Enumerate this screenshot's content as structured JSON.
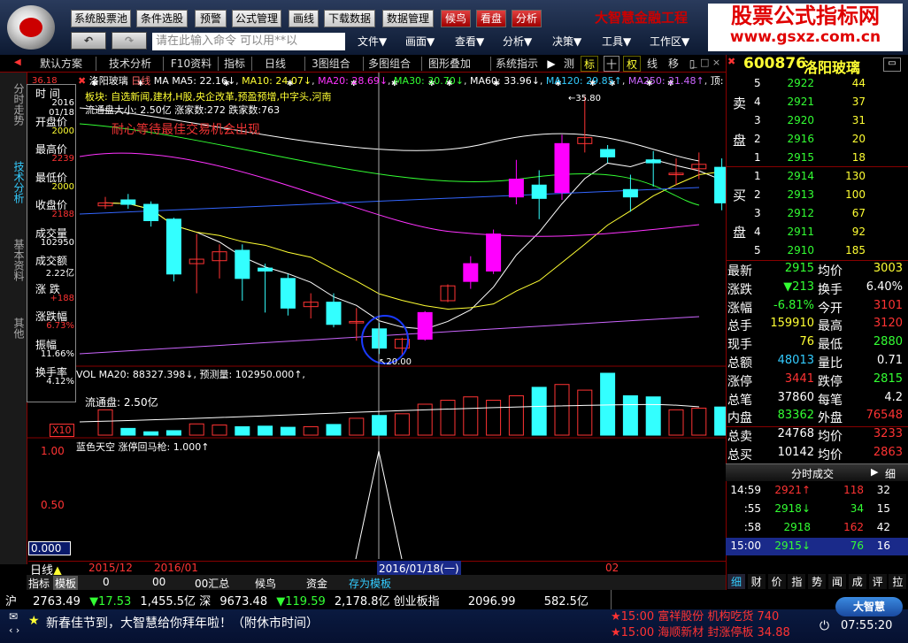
{
  "topbar": {
    "buttons": [
      "系统股票池",
      "条件选股",
      "预警",
      "公式管理",
      "画线",
      "下载数据",
      "数据管理",
      "候鸟",
      "看盘",
      "分析"
    ],
    "brand": "大智慧金融工程",
    "watermark_line1": "股票公式指标网",
    "watermark_line2": "www.gsxz.com.cn",
    "command_placeholder": "请在此输入命令  可以用**以",
    "menus": [
      "文件▼",
      "画面▼",
      "查看▼",
      "分析▼",
      "决策▼",
      "工具▼",
      "工作区▼"
    ],
    "window_buttons": [
      "_",
      "□",
      "×"
    ]
  },
  "toolbar": {
    "tabs": [
      "默认方案",
      "技术分析",
      "F10资料",
      "指标",
      "日线",
      "3图组合",
      "多图组合",
      "图形叠加",
      "系统指示"
    ],
    "right_tabs": [
      "测",
      "标",
      "十",
      "权",
      "线",
      "移"
    ]
  },
  "sidetabs": [
    "分时走势",
    "技术分析",
    "基本资料",
    "其他"
  ],
  "chart": {
    "title": "洛阳玻璃",
    "period": "日线",
    "ma_line": {
      "ma": "MA",
      "ma5": "MA5: 22.16↓",
      "ma10": "MA10: 24.07↓",
      "ma20": "MA20: 28.69↓",
      "ma30": "MA30: 30.70↓",
      "ma60": "MA60: 33.96↓",
      "ma120": "MA120: 29.85↑",
      "ma250": "MA250: 21.48↑",
      "top": "顶: 36"
    },
    "block_info": "板块: 自选新闻,建材,H股,央企改革,预盈预增,中字头,河南",
    "float_info": "流通盘大小: 2.50亿   涨家数:272   跌家数:763",
    "annotation": "耐心等待最佳交易机会出现",
    "high_label": "35.80",
    "low_label": "20.00",
    "y_top_label": "36.18",
    "vol_header": "VOL MA20: 88327.398↓, 预测量: 102950.000↑,",
    "vol_float": "流通盘: 2.50亿",
    "vol_unit": "X10",
    "ind_header_name": "蓝色天空",
    "ind_header_value": "涨停回马枪: 1.000↑",
    "ind_y_labels": [
      "1.00",
      "0.50",
      "0.000"
    ],
    "x_labels": [
      "2015/12",
      "2016/01",
      "2016/01/18(一)",
      "02"
    ],
    "candles": [
      {
        "o": 28.4,
        "c": 28.6,
        "h": 29.0,
        "l": 28.2,
        "up": true
      },
      {
        "o": 28.8,
        "c": 28.5,
        "h": 29.2,
        "l": 28.2,
        "up": false
      },
      {
        "o": 28.5,
        "c": 27.4,
        "h": 28.7,
        "l": 27.0,
        "up": false
      },
      {
        "o": 27.5,
        "c": 23.8,
        "h": 27.6,
        "l": 23.3,
        "up": false
      },
      {
        "o": 24.5,
        "c": 24.8,
        "h": 26.5,
        "l": 22.5,
        "up": true
      },
      {
        "o": 24.7,
        "c": 25.3,
        "h": 25.8,
        "l": 23.5,
        "up": true
      },
      {
        "o": 25.4,
        "c": 23.5,
        "h": 25.8,
        "l": 22.0,
        "up": false
      },
      {
        "o": 24.2,
        "c": 24.0,
        "h": 24.5,
        "l": 21.2,
        "up": false
      },
      {
        "o": 23.5,
        "c": 21.5,
        "h": 23.8,
        "l": 21.0,
        "up": false
      },
      {
        "o": 21.6,
        "c": 21.9,
        "h": 22.5,
        "l": 20.8,
        "up": true
      },
      {
        "o": 21.9,
        "c": 20.4,
        "h": 22.5,
        "l": 20.2,
        "up": false
      },
      {
        "o": 20.5,
        "c": 20.6,
        "h": 21.5,
        "l": 19.3,
        "up": true
      },
      {
        "o": 20.1,
        "c": 18.8,
        "h": 20.5,
        "l": 18.4,
        "up": false
      },
      {
        "o": 18.8,
        "c": 19.4,
        "h": 19.5,
        "l": 18.3,
        "up": true
      },
      {
        "o": 19.4,
        "c": 21.2,
        "h": 21.3,
        "l": 19.3,
        "up": true
      },
      {
        "o": 22.0,
        "c": 23.0,
        "h": 23.1,
        "l": 21.9,
        "up": true
      },
      {
        "o": 23.3,
        "c": 24.5,
        "h": 25.0,
        "l": 22.8,
        "up": true
      },
      {
        "o": 24.0,
        "c": 26.5,
        "h": 26.8,
        "l": 23.8,
        "up": true
      },
      {
        "o": 29.0,
        "c": 30.2,
        "h": 31.5,
        "l": 28.5,
        "up": true
      },
      {
        "o": 29.8,
        "c": 28.9,
        "h": 30.8,
        "l": 27.5,
        "up": false
      },
      {
        "o": 29.3,
        "c": 32.6,
        "h": 33.2,
        "l": 28.8,
        "up": true
      },
      {
        "o": 32.6,
        "c": 33.0,
        "h": 35.8,
        "l": 32.0,
        "up": true
      },
      {
        "o": 32.2,
        "c": 31.7,
        "h": 32.5,
        "l": 31.3,
        "up": false
      },
      {
        "o": 29.5,
        "c": 29.0,
        "h": 30.5,
        "l": 28.0,
        "up": false
      },
      {
        "o": 31.5,
        "c": 31.3,
        "h": 32.1,
        "l": 29.7,
        "up": false
      },
      {
        "o": 30.5,
        "c": 30.6,
        "h": 31.6,
        "l": 29.8,
        "up": true
      },
      {
        "o": 30.9,
        "c": 31.2,
        "h": 32.0,
        "l": 30.2,
        "up": true
      },
      {
        "o": 31.0,
        "c": 28.6,
        "h": 31.6,
        "l": 28.1,
        "up": false
      }
    ],
    "volumes": [
      45,
      12,
      6,
      8,
      20,
      18,
      15,
      16,
      14,
      15,
      19,
      30,
      35,
      38,
      55,
      62,
      68,
      62,
      70,
      85,
      90,
      80,
      110,
      70,
      68,
      45,
      48,
      50
    ]
  },
  "info_box": {
    "rows": [
      {
        "label": "时 间",
        "value": "2016\n01/18",
        "color": "w"
      },
      {
        "label": "开盘价",
        "value": "2000",
        "color": "y"
      },
      {
        "label": "最高价",
        "value": "2239",
        "color": "r"
      },
      {
        "label": "最低价",
        "value": "2000",
        "color": "y"
      },
      {
        "label": "收盘价",
        "value": "2188",
        "color": "r"
      },
      {
        "label": "成交量",
        "value": "102950",
        "color": "w"
      },
      {
        "label": "成交额",
        "value": "2.22亿",
        "color": "w"
      },
      {
        "label": "涨 跌",
        "value": "+188",
        "color": "r"
      },
      {
        "label": "涨跌幅",
        "value": "6.73%",
        "color": "r"
      },
      {
        "label": "振幅",
        "value": "11.66%",
        "color": "w"
      },
      {
        "label": "换手率",
        "value": "4.12%",
        "color": "w"
      }
    ]
  },
  "rpanel": {
    "code": "600876",
    "name": "洛阳玻璃",
    "sell": [
      {
        "n": "5",
        "p": "2922",
        "v": "44"
      },
      {
        "n": "4",
        "p": "2921",
        "v": "37"
      },
      {
        "n": "3",
        "p": "2920",
        "v": "31"
      },
      {
        "n": "2",
        "p": "2916",
        "v": "20"
      },
      {
        "n": "1",
        "p": "2915",
        "v": "18"
      }
    ],
    "buy": [
      {
        "n": "1",
        "p": "2914",
        "v": "130"
      },
      {
        "n": "2",
        "p": "2913",
        "v": "100"
      },
      {
        "n": "3",
        "p": "2912",
        "v": "67"
      },
      {
        "n": "4",
        "p": "2911",
        "v": "92"
      },
      {
        "n": "5",
        "p": "2910",
        "v": "185"
      }
    ],
    "sell_label": [
      "卖",
      "盘"
    ],
    "buy_label": [
      "买",
      "盘"
    ],
    "stats": [
      {
        "l1": "最新",
        "v1": "2915",
        "c1": "g",
        "l2": "均价",
        "v2": "3003",
        "c2": "y"
      },
      {
        "l1": "涨跌",
        "v1": "▼213",
        "c1": "g",
        "l2": "换手",
        "v2": "6.40%",
        "c2": "w"
      },
      {
        "l1": "涨幅",
        "v1": "-6.81%",
        "c1": "g",
        "l2": "今开",
        "v2": "3101",
        "c2": "r"
      },
      {
        "l1": "总手",
        "v1": "159910",
        "c1": "y",
        "l2": "最高",
        "v2": "3120",
        "c2": "r"
      },
      {
        "l1": "现手",
        "v1": "76",
        "c1": "y",
        "l2": "最低",
        "v2": "2880",
        "c2": "g"
      },
      {
        "l1": "总额",
        "v1": "48013",
        "c1": "c",
        "l2": "量比",
        "v2": "0.71",
        "c2": "w"
      },
      {
        "l1": "涨停",
        "v1": "3441",
        "c1": "r",
        "l2": "跌停",
        "v2": "2815",
        "c2": "g"
      },
      {
        "l1": "总笔",
        "v1": "37860",
        "c1": "w",
        "l2": "每笔",
        "v2": "4.2",
        "c2": "w"
      },
      {
        "l1": "内盘",
        "v1": "83362",
        "c1": "g",
        "l2": "外盘",
        "v2": "76548",
        "c2": "r"
      },
      {
        "l1": "总卖",
        "v1": "24768",
        "c1": "w",
        "l2": "均价",
        "v2": "3233",
        "c2": "r"
      },
      {
        "l1": "总买",
        "v1": "10142",
        "c1": "w",
        "l2": "均价",
        "v2": "2863",
        "c2": "r"
      }
    ],
    "trades_title": "分时成交",
    "trades_btn": "细",
    "trades": [
      {
        "t": "14:59",
        "p": "2921↑",
        "pc": "r",
        "v": "118",
        "vc": "r",
        "n": "32"
      },
      {
        "t": ":55",
        "p": "2918↓",
        "pc": "g",
        "v": "34",
        "vc": "g",
        "n": "15"
      },
      {
        "t": ":58",
        "p": "2918",
        "pc": "g",
        "v": "162",
        "vc": "r",
        "n": "42"
      },
      {
        "t": "15:00",
        "p": "2915↓",
        "pc": "g",
        "v": "76",
        "vc": "g",
        "n": "16"
      }
    ],
    "bottom_tabs": [
      "细",
      "财",
      "价",
      "指",
      "势",
      "闻",
      "成",
      "评",
      "拉"
    ]
  },
  "bottom_tabs": [
    "指标",
    "模板",
    "0",
    "00",
    "00汇总",
    "候鸟",
    "资金",
    "存为模板"
  ],
  "period_label": "日线",
  "ticker": {
    "sh_label": "沪",
    "sh_index": "2763.49",
    "sh_change": "▼17.53",
    "sh_amount": "1,455.5亿",
    "sz_label": "深",
    "sz_index": "9673.48",
    "sz_change": "▼119.59",
    "sz_amount": "2,178.8亿",
    "gem_label": "创业板指",
    "gem_index": "2096.99",
    "gem_amount": "582.5亿"
  },
  "news": {
    "main": "新春佳节到，大智慧给你拜年啦！（附休市时间）",
    "alerts": [
      "★15:00 富祥股份 机构吃货 740",
      "★15:00 海顺新材 封涨停板 34.88"
    ],
    "logo": "大智慧",
    "time": "07:55:20"
  }
}
